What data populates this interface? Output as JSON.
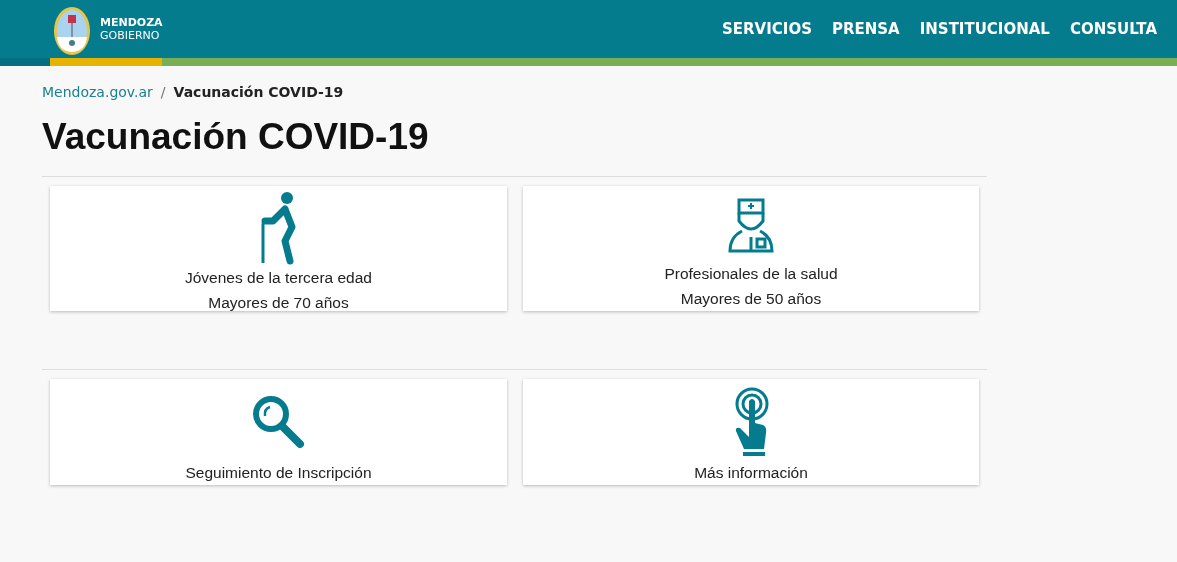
{
  "header": {
    "logo_line1": "MENDOZA",
    "logo_line2": "GOBIERNO",
    "nav": [
      "SERVICIOS",
      "PRENSA",
      "INSTITUCIONAL",
      "CONSULTA"
    ]
  },
  "breadcrumb": {
    "link": "Mendoza.gov.ar",
    "separator": "/",
    "current": "Vacunación COVID-19"
  },
  "title": "Vacunación COVID-19",
  "sections": [
    {
      "cards": [
        {
          "kind": "elder",
          "lines": [
            "Jóvenes de la tercera edad",
            "Mayores de 70 años"
          ]
        },
        {
          "kind": "nurse",
          "lines": [
            "Profesionales de la salud",
            "Mayores de 50 años"
          ]
        }
      ]
    },
    {
      "cards": [
        {
          "kind": "search",
          "lines": [
            "Seguimiento de Inscripción"
          ]
        },
        {
          "kind": "touch",
          "lines": [
            "Más información"
          ]
        }
      ]
    }
  ]
}
